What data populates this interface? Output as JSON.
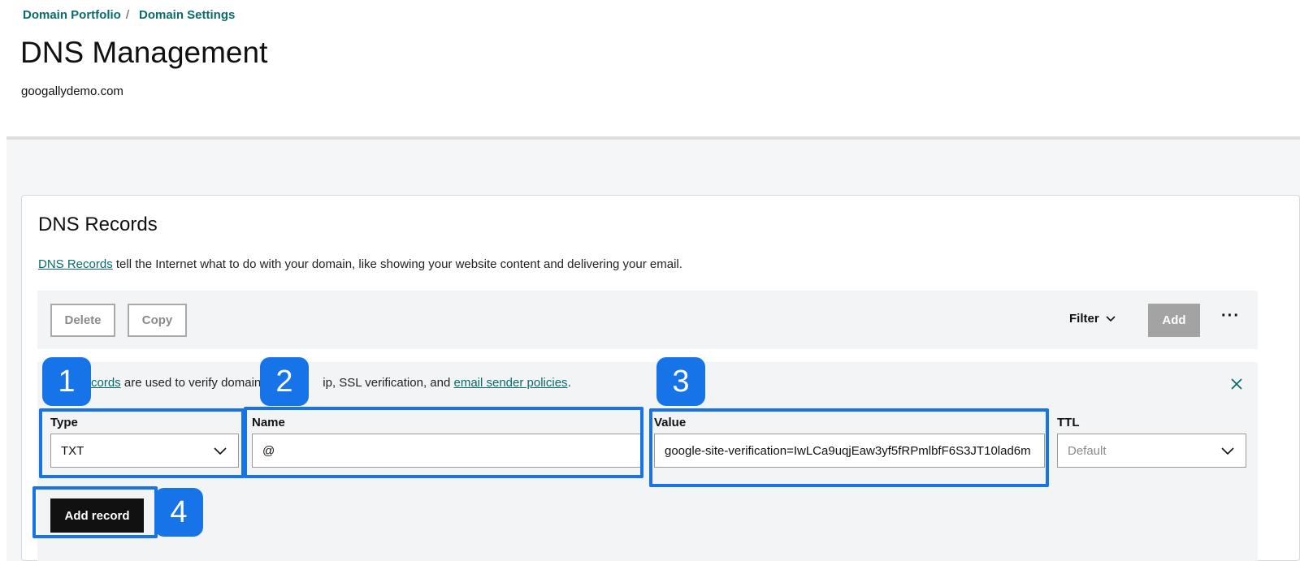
{
  "breadcrumb": {
    "items": [
      "Domain Portfolio",
      "Domain Settings"
    ],
    "separator": "/"
  },
  "page": {
    "title": "DNS Management",
    "domain": "googallydemo.com"
  },
  "card": {
    "title": "DNS Records",
    "desc_link": "DNS Records",
    "desc_text": " tell the Internet what to do with your domain, like showing your website content and delivering your email."
  },
  "toolbar": {
    "delete_label": "Delete",
    "copy_label": "Copy",
    "filter_label": "Filter",
    "add_label": "Add",
    "more_label": "···"
  },
  "notice": {
    "link1": "cords",
    "text1": " are used to verify domain",
    "text2": "ip, SSL verification, and ",
    "link2": "email sender policies",
    "text3": "."
  },
  "form": {
    "type_label": "Type",
    "type_value": "TXT",
    "name_label": "Name",
    "name_value": "@",
    "value_label": "Value",
    "value_value": "google-site-verification=IwLCa9uqjEaw3yf5fRPmlbfF6S3JT10lad6m",
    "ttl_label": "TTL",
    "ttl_value": "Default",
    "add_record_label": "Add record"
  },
  "callouts": [
    "1",
    "2",
    "3",
    "4"
  ],
  "colors": {
    "accent_teal": "#0a6b6b",
    "highlight_blue": "#1673e8",
    "primary_button": "#111111"
  }
}
